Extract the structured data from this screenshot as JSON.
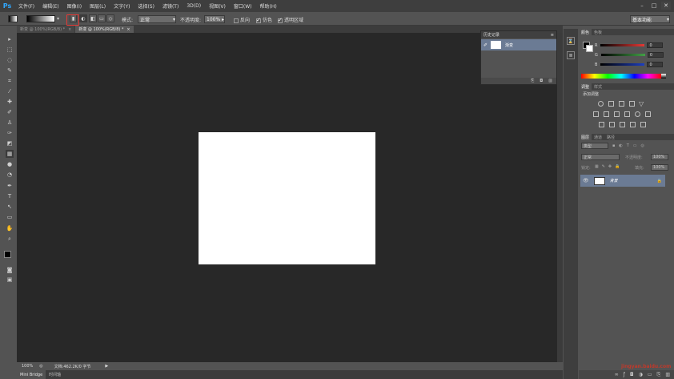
{
  "app": {
    "logo": "Ps"
  },
  "menu": [
    "文件(F)",
    "编辑(E)",
    "图像(I)",
    "图层(L)",
    "文字(Y)",
    "选择(S)",
    "滤镜(T)",
    "3D(D)",
    "视图(V)",
    "窗口(W)",
    "帮助(H)"
  ],
  "options": {
    "mode_label": "模式:",
    "mode_value": "正常",
    "opacity_label": "不透明度:",
    "opacity_value": "100%",
    "reverse_label": "反向",
    "dither_label": "仿色",
    "transparency_label": "透明区域",
    "workspace": "基本功能"
  },
  "tabs": [
    {
      "label": "新变 @ 100%(RGB/8) *"
    },
    {
      "label": "新变 @ 100%(RGB/8) *"
    }
  ],
  "history": {
    "tabs": [
      "历史记录"
    ],
    "state_label": "渐变"
  },
  "color_panel": {
    "tabs": [
      "颜色",
      "色板"
    ],
    "channels": [
      {
        "label": "R",
        "value": "0",
        "color": "#e53935"
      },
      {
        "label": "G",
        "value": "0",
        "color": "#43a047"
      },
      {
        "label": "B",
        "value": "0",
        "color": "#1e3fbf"
      }
    ]
  },
  "adjust_panel": {
    "tabs": [
      "调整",
      "样式"
    ],
    "title": "添加调整"
  },
  "layers_panel": {
    "tabs": [
      "图层",
      "通道",
      "路径"
    ],
    "filter_label": "类型",
    "blend_mode": "正常",
    "opacity_label": "不透明度:",
    "opacity_value": "100%",
    "lock_label": "锁定:",
    "fill_label": "填充:",
    "fill_value": "100%",
    "layer_name": "背景"
  },
  "status": {
    "zoom": "100%",
    "doc_info": "文档:462.2K/0 字节"
  },
  "bottom_tabs": [
    "Mini Bridge",
    "时间轴"
  ],
  "watermark": "jingyan.baidu.com",
  "colors": {
    "accent_red": "#e53935",
    "selection_blue": "#6b7b94"
  }
}
